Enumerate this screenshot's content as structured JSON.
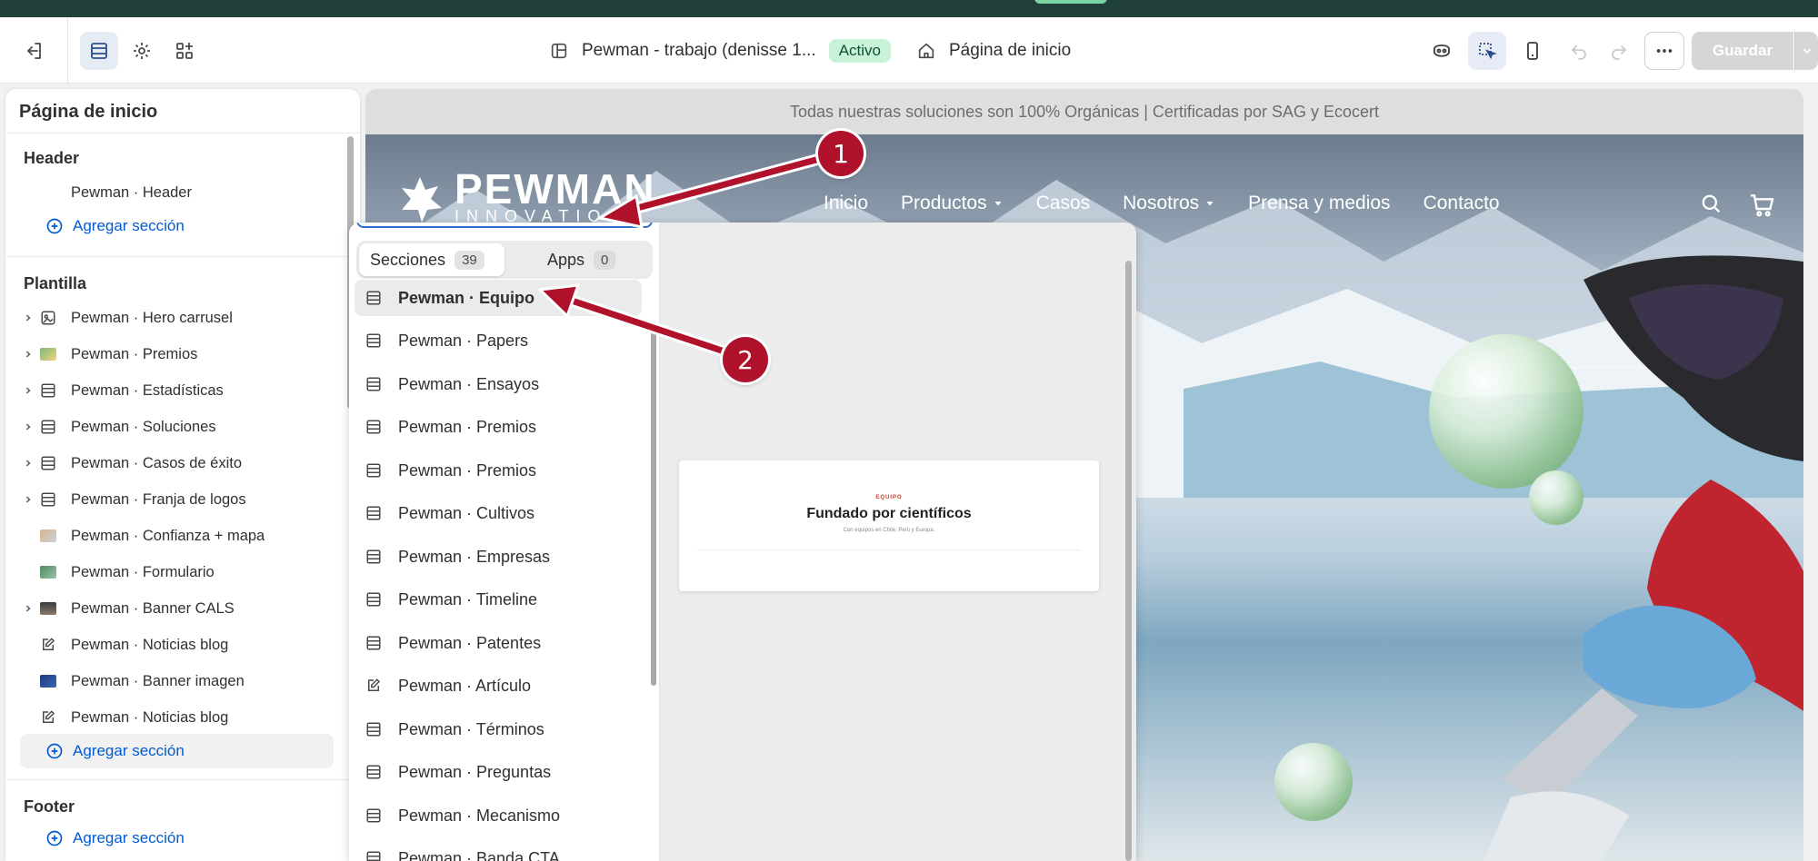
{
  "toolbar": {
    "theme_name": "Pewman - trabajo (denisse 1...",
    "theme_status": "Activo",
    "page_name": "Página de inicio",
    "save_label": "Guardar"
  },
  "sidebar": {
    "title": "Página de inicio",
    "header_label": "Header",
    "header_items": [
      {
        "label": "Pewman · Header"
      }
    ],
    "add_section": "Agregar sección",
    "template_label": "Plantilla",
    "template_items": [
      {
        "label": "Pewman · Hero carrusel",
        "icon": "hero-icon"
      },
      {
        "label": "Pewman · Premios",
        "icon": "image-thumb"
      },
      {
        "label": "Pewman · Estadísticas",
        "icon": "section-icon"
      },
      {
        "label": "Pewman · Soluciones",
        "icon": "section-icon"
      },
      {
        "label": "Pewman · Casos de éxito",
        "icon": "section-icon"
      },
      {
        "label": "Pewman · Franja de logos",
        "icon": "section-icon"
      },
      {
        "label": "Pewman · Confianza + mapa",
        "icon": "image-thumb"
      },
      {
        "label": "Pewman · Formulario",
        "icon": "image-thumb"
      },
      {
        "label": "Pewman · Banner CALS",
        "icon": "image-thumb"
      },
      {
        "label": "Pewman · Noticias blog",
        "icon": "blog-icon"
      },
      {
        "label": "Pewman · Banner imagen",
        "icon": "image-thumb"
      },
      {
        "label": "Pewman · Noticias blog",
        "icon": "blog-icon"
      }
    ],
    "footer_label": "Footer"
  },
  "preview": {
    "announcement": "Todas nuestras soluciones son 100% Orgánicas | Certificadas por SAG y Ecocert",
    "logo_text": "PEWMAN",
    "logo_sub": "INNOVATIO",
    "nav": [
      "Inicio",
      "Productos",
      "Casos",
      "Nosotros",
      "Prensa y medios",
      "Contacto"
    ]
  },
  "picker": {
    "tab_sections": "Secciones",
    "tab_sections_count": "39",
    "tab_apps": "Apps",
    "tab_apps_count": "0",
    "items": [
      "Pewman · Equipo",
      "Pewman · Papers",
      "Pewman · Ensayos",
      "Pewman · Premios",
      "Pewman · Premios",
      "Pewman · Cultivos",
      "Pewman · Empresas",
      "Pewman · Timeline",
      "Pewman · Patentes",
      "Pewman · Artículo",
      "Pewman · Términos",
      "Pewman · Preguntas",
      "Pewman · Mecanismo",
      "Pewman · Banda CTA"
    ]
  },
  "preview_card": {
    "kicker": "EQUIPO",
    "title": "Fundado por científicos",
    "subtitle": "Con equipos en Chile, Perú y Europa."
  },
  "annotations": {
    "one": "1",
    "two": "2"
  },
  "colors": {
    "accent": "#005bd3",
    "callout": "#b0112b",
    "active_badge": "#c9f3d8"
  }
}
